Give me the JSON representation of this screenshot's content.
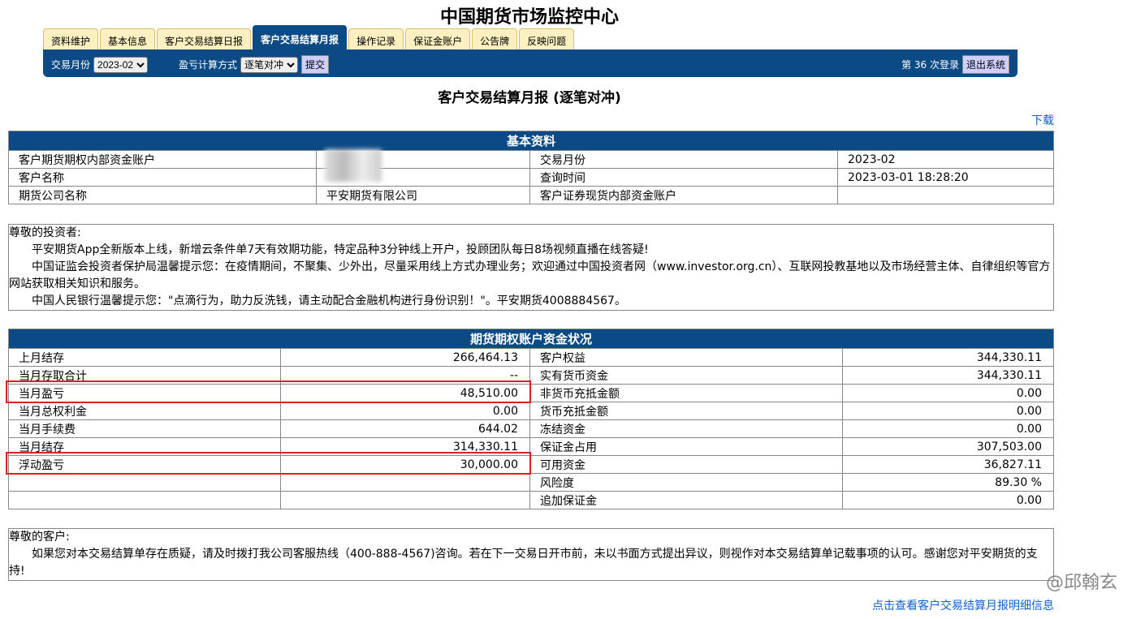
{
  "title": "中国期货市场监控中心",
  "tabs": [
    "资料维护",
    "基本信息",
    "客户交易结算日报",
    "客户交易结算月报",
    "操作记录",
    "保证金账户",
    "公告牌",
    "反映问题"
  ],
  "toolbar": {
    "month_label": "交易月份",
    "month_value": "2023-02",
    "method_label": "盈亏计算方式",
    "method_value": "逐笔对冲",
    "submit": "提交",
    "login_count": "第 36 次登录",
    "logout": "退出系统"
  },
  "page_title": "客户交易结算月报 (逐笔对冲)",
  "download": "下载",
  "basic": {
    "header": "基本资料",
    "rows": [
      [
        "客户期货期权内部资金账户",
        "",
        "交易月份",
        "2023-02"
      ],
      [
        "客户名称",
        "",
        "查询时间",
        "2023-03-01 18:28:20"
      ],
      [
        "期货公司名称",
        "平安期货有限公司",
        "客户证券现货内部资金账户",
        ""
      ]
    ]
  },
  "notice": {
    "greeting": "尊敬的投资者:",
    "lines": [
      "平安期货App全新版本上线，新增云条件单7天有效期功能，特定品种3分钟线上开户，投顾团队每日8场视频直播在线答疑!",
      "中国证监会投资者保护局温馨提示您：在疫情期间，不聚集、少外出，尽量采用线上方式办理业务；欢迎通过中国投资者网（www.investor.org.cn）、互联网投教基地以及市场经营主体、自律组织等官方网站获取相关知识和服务。",
      "中国人民银行温馨提示您：\"点滴行为，助力反洗钱，请主动配合金融机构进行身份识别！\"。平安期货4008884567。"
    ]
  },
  "funds": {
    "header": "期货期权账户资金状况",
    "rows": [
      [
        "上月结存",
        "266,464.13",
        "客户权益",
        "344,330.11"
      ],
      [
        "当月存取合计",
        "--",
        "实有货币资金",
        "344,330.11"
      ],
      [
        "当月盈亏",
        "48,510.00",
        "非货币充抵金额",
        "0.00"
      ],
      [
        "当月总权利金",
        "0.00",
        "货币充抵金额",
        "0.00"
      ],
      [
        "当月手续费",
        "644.02",
        "冻结资金",
        "0.00"
      ],
      [
        "当月结存",
        "314,330.11",
        "保证金占用",
        "307,503.00"
      ],
      [
        "浮动盈亏",
        "30,000.00",
        "可用资金",
        "36,827.11"
      ],
      [
        "",
        "",
        "风险度",
        "89.30 %"
      ],
      [
        "",
        "",
        "追加保证金",
        "0.00"
      ]
    ]
  },
  "notice2": {
    "greeting": "尊敬的客户:",
    "text": "如果您对本交易结算单存在质疑，请及时拨打我公司客服热线（400-888-4567)咨询。若在下一交易日开市前，未以书面方式提出异议，则视作对本交易结算单记载事项的认可。感谢您对平安期货的支持!"
  },
  "watermark": "@邱翰玄",
  "footer_link": "点击查看客户交易结算月报明细信息"
}
